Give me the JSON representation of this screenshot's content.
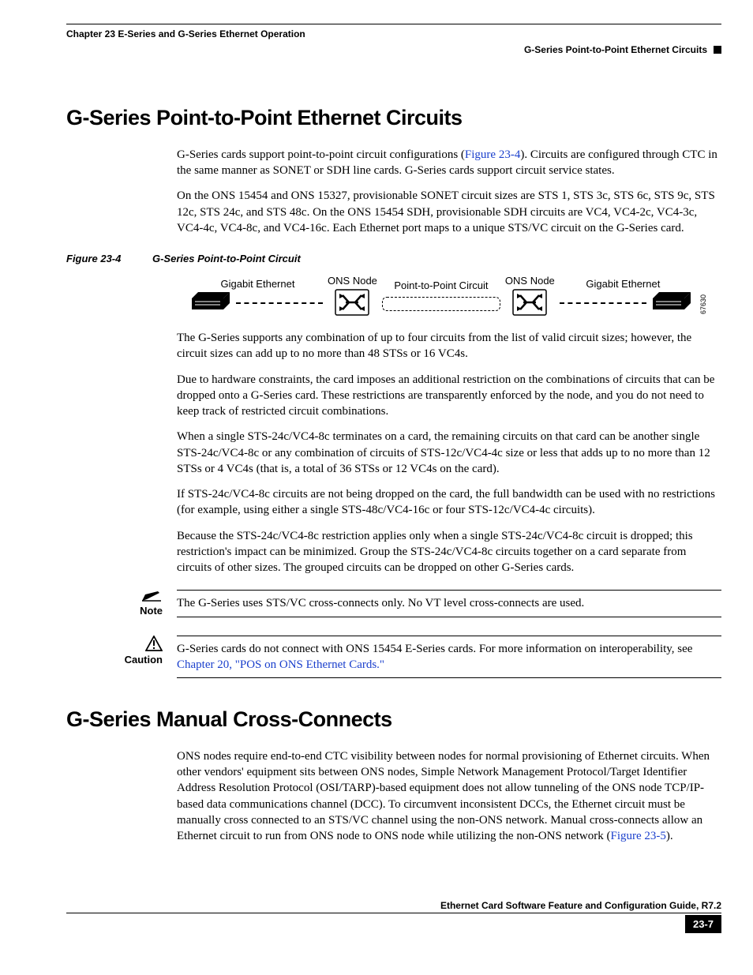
{
  "header": {
    "chapter": "Chapter 23 E-Series and G-Series Ethernet Operation",
    "section": "G-Series Point-to-Point Ethernet Circuits"
  },
  "h1_a": "G-Series Point-to-Point Ethernet Circuits",
  "p1a": "G-Series cards support point-to-point circuit configurations (",
  "p1link": "Figure 23-4",
  "p1b": "). Circuits are configured through CTC in the same manner as SONET or SDH line cards. G-Series cards support circuit service states.",
  "p2": "On the ONS 15454 and ONS 15327, provisionable SONET circuit sizes are STS 1, STS 3c, STS 6c, STS 9c, STS 12c, STS 24c, and STS 48c. On the ONS 15454 SDH, provisionable SDH circuits are VC4, VC4-2c, VC4-3c, VC4-4c, VC4-8c, and VC4-16c. Each Ethernet port maps to a unique STS/VC circuit on the G-Series card.",
  "figcap_num": "Figure 23-4",
  "figcap_title": "G-Series Point-to-Point Circuit",
  "diagram": {
    "ons_node": "ONS Node",
    "gige": "Gigabit Ethernet",
    "ptp": "Point-to-Point Circuit",
    "id": "67630"
  },
  "p3": "The G-Series supports any combination of up to four circuits from the list of valid circuit sizes; however, the circuit sizes can add up to no more than 48 STSs or 16 VC4s.",
  "p4": "Due to hardware constraints, the card imposes an additional restriction on the combinations of circuits that can be dropped onto a G-Series card. These restrictions are transparently enforced by the node, and you do not need to keep track of restricted circuit combinations.",
  "p5": "When a single STS-24c/VC4-8c terminates on a card, the remaining circuits on that card can be another single STS-24c/VC4-8c or any combination of circuits of STS-12c/VC4-4c size or less that adds up to no more than 12 STSs or 4 VC4s (that is, a total of 36 STSs or 12 VC4s on the card).",
  "p6": "If STS-24c/VC4-8c circuits are not being dropped on the card, the full bandwidth can be used with no restrictions (for example, using either a single STS-48c/VC4-16c or four STS-12c/VC4-4c circuits).",
  "p7": "Because the STS-24c/VC4-8c restriction applies only when a single STS-24c/VC4-8c circuit is dropped; this restriction's impact can be minimized. Group the STS-24c/VC4-8c circuits together on a card separate from circuits of other sizes. The grouped circuits can be dropped on other G-Series cards.",
  "note_label": "Note",
  "note_text": "The G-Series uses STS/VC cross-connects only. No VT level cross-connects are used.",
  "caution_label": "Caution",
  "caution_a": "G-Series cards do not connect with ONS 15454 E-Series cards. For more information on interoperability, see ",
  "caution_link": "Chapter 20, \"POS on ONS Ethernet Cards.\"",
  "h1_b": "G-Series Manual Cross-Connects",
  "p8a": "ONS nodes require end-to-end CTC visibility between nodes for normal provisioning of Ethernet circuits. When other vendors' equipment sits between ONS nodes, Simple Network Management Protocol/Target Identifier Address Resolution Protocol (OSI/TARP)-based equipment does not allow tunneling of the ONS node TCP/IP-based data communications channel (DCC). To circumvent inconsistent DCCs, the Ethernet circuit must be manually cross connected to an STS/VC channel using the non-ONS network. Manual cross-connects allow an Ethernet circuit to run from ONS node to ONS node while utilizing the non-ONS network (",
  "p8link": "Figure 23-5",
  "p8b": ").",
  "footer": {
    "book": "Ethernet Card Software Feature and Configuration Guide, R7.2",
    "page": "23-7"
  }
}
